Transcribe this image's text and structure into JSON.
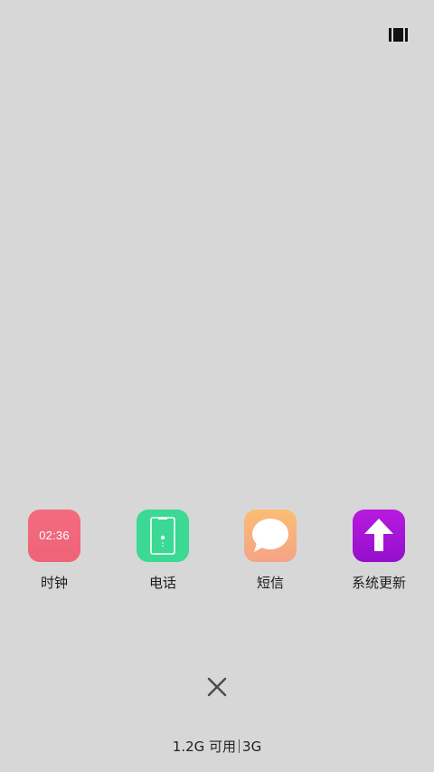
{
  "header": {
    "view_toggle_icon": "recents-view-icon"
  },
  "apps": [
    {
      "label": "时钟",
      "icon": "clock-icon",
      "icon_text": "02:36",
      "color": "#f26a7d"
    },
    {
      "label": "电话",
      "icon": "phone-icon",
      "color": "#3bd993"
    },
    {
      "label": "短信",
      "icon": "message-icon",
      "color": "#f8b07a"
    },
    {
      "label": "系统更新",
      "icon": "system-update-icon",
      "color": "#a313d6"
    }
  ],
  "footer": {
    "close_icon": "close-icon",
    "memory_available": "1.2G 可用",
    "memory_total": "3G"
  }
}
